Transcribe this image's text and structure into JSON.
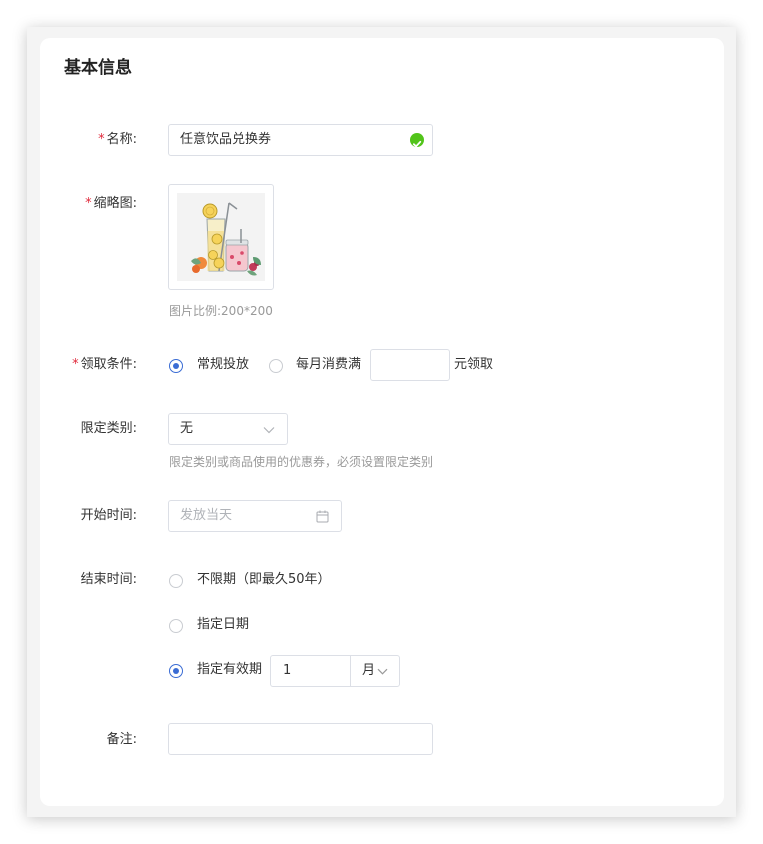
{
  "section": {
    "title": "基本信息"
  },
  "form": {
    "required_mark": "*",
    "name": {
      "label": "名称:",
      "value": "任意饮品兑换券"
    },
    "thumbnail": {
      "label": "缩略图:",
      "hint": "图片比例:200*200"
    },
    "claim_condition": {
      "label": "领取条件:",
      "options": [
        "常规投放",
        "每月消费满"
      ],
      "suffix": "元领取",
      "amount_value": ""
    },
    "category": {
      "label": "限定类别:",
      "selected": "无",
      "hint": "限定类别或商品使用的优惠券，必须设置限定类别"
    },
    "start_time": {
      "label": "开始时间:",
      "placeholder": "发放当天"
    },
    "end_time": {
      "label": "结束时间:",
      "options": [
        "不限期（即最久50年）",
        "指定日期",
        "指定有效期"
      ],
      "period_value": "1",
      "period_unit": "月"
    },
    "remark": {
      "label": "备注:",
      "value": ""
    }
  },
  "colors": {
    "accent": "#3a6cd4",
    "required": "#e0293b",
    "success": "#52c41a"
  },
  "icons": {
    "valid": "check-circle-icon",
    "dropdown": "chevron-down-icon",
    "calendar": "calendar-icon",
    "thumbnail": "drink-illustration-icon"
  }
}
